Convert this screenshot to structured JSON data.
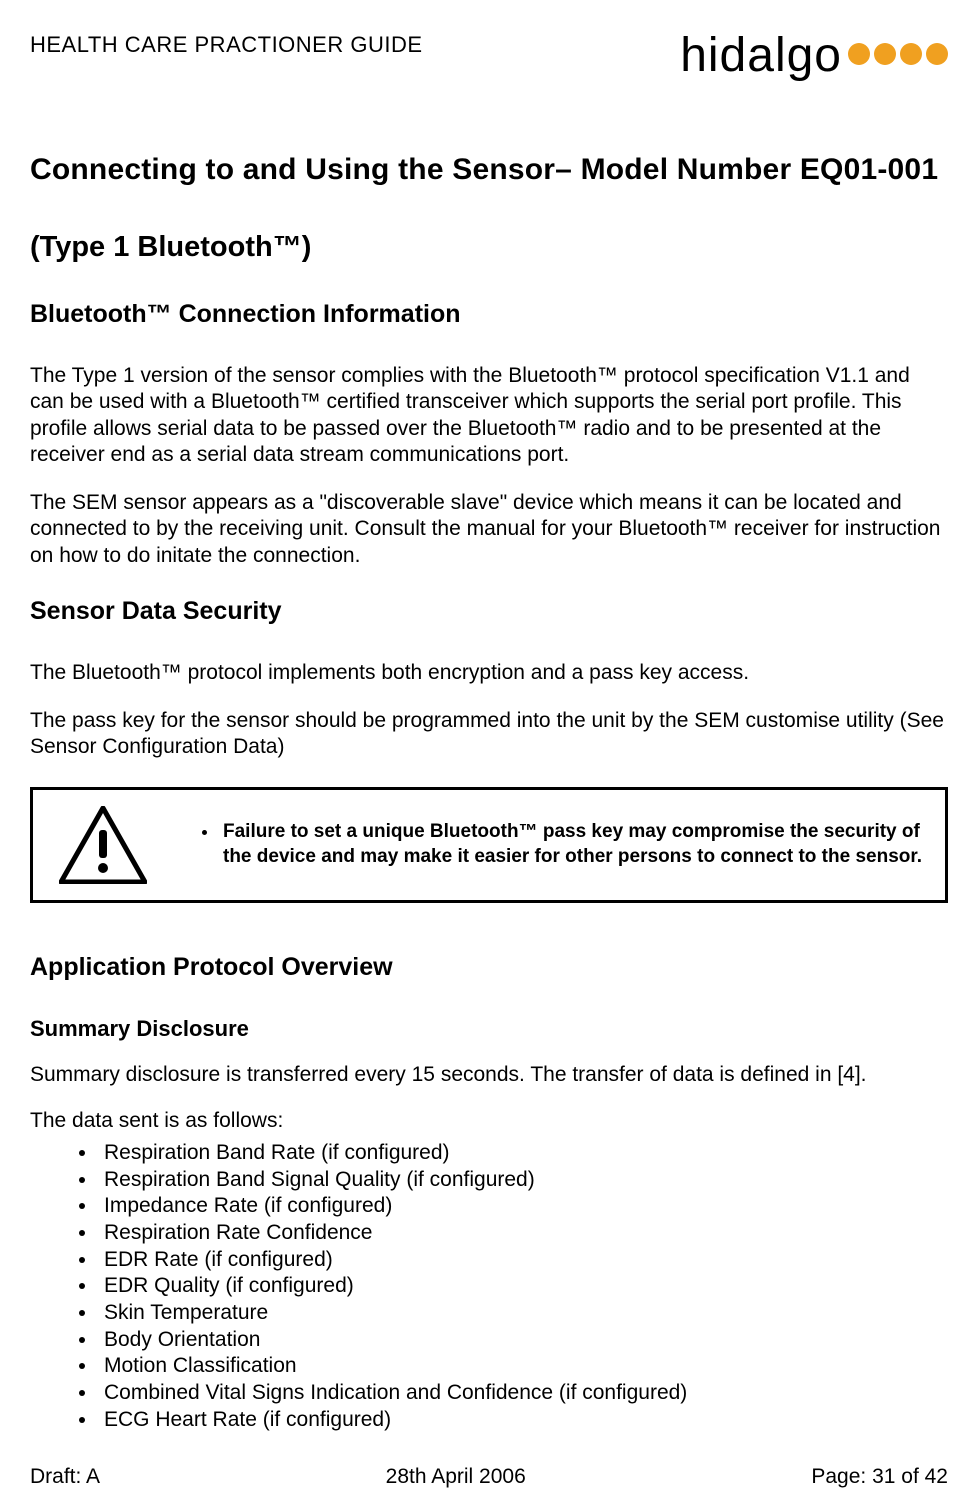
{
  "header": {
    "doc_title": "HEALTH CARE PRACTIONER GUIDE",
    "brand": "hidalgo"
  },
  "h1": "Connecting to and Using the Sensor– Model Number EQ01-001",
  "h2": "(Type 1  Bluetooth™)",
  "sec1": {
    "title": "Bluetooth™   Connection Information",
    "p1": "The Type 1 version of the sensor complies with the Bluetooth™  protocol specification V1.1 and can be used with a Bluetooth™  certified transceiver which supports the serial port profile. This profile allows serial data to be passed over the Bluetooth™  radio and to be presented at the receiver end as a serial data stream communications port.",
    "p2": "The SEM sensor appears as a \"discoverable slave\" device which means it can be located and connected to by the receiving unit. Consult the manual for your Bluetooth™  receiver for instruction on how to do initate the connection."
  },
  "sec2": {
    "title": "Sensor Data Security",
    "p1": "The Bluetooth™  protocol implements both encryption and a pass key access.",
    "p2": "The pass key for the sensor should be programmed into the unit by the SEM customise utility (See Sensor Configuration Data)"
  },
  "callout": {
    "text": "Failure to set a unique Bluetooth™  pass key may compromise the security of the device and may make it easier for other persons to connect to the sensor."
  },
  "sec3": {
    "title": "Application Protocol Overview",
    "sub_title": "Summary Disclosure",
    "p1": "Summary disclosure is transferred every 15 seconds.  The transfer of data is defined in [4].",
    "p2": "The data sent is as follows:",
    "items": [
      "Respiration Band Rate (if configured)",
      "Respiration Band Signal Quality (if configured)",
      "Impedance Rate (if configured)",
      "Respiration Rate Confidence",
      "EDR Rate (if configured)",
      "EDR Quality (if configured)",
      "Skin Temperature",
      "Body Orientation",
      "Motion Classification",
      "Combined Vital Signs Indication and Confidence (if configured)",
      "ECG Heart Rate (if configured)"
    ]
  },
  "footer": {
    "left": "Draft: A",
    "center": "28th April 2006",
    "right": "Page: 31 of 42"
  }
}
